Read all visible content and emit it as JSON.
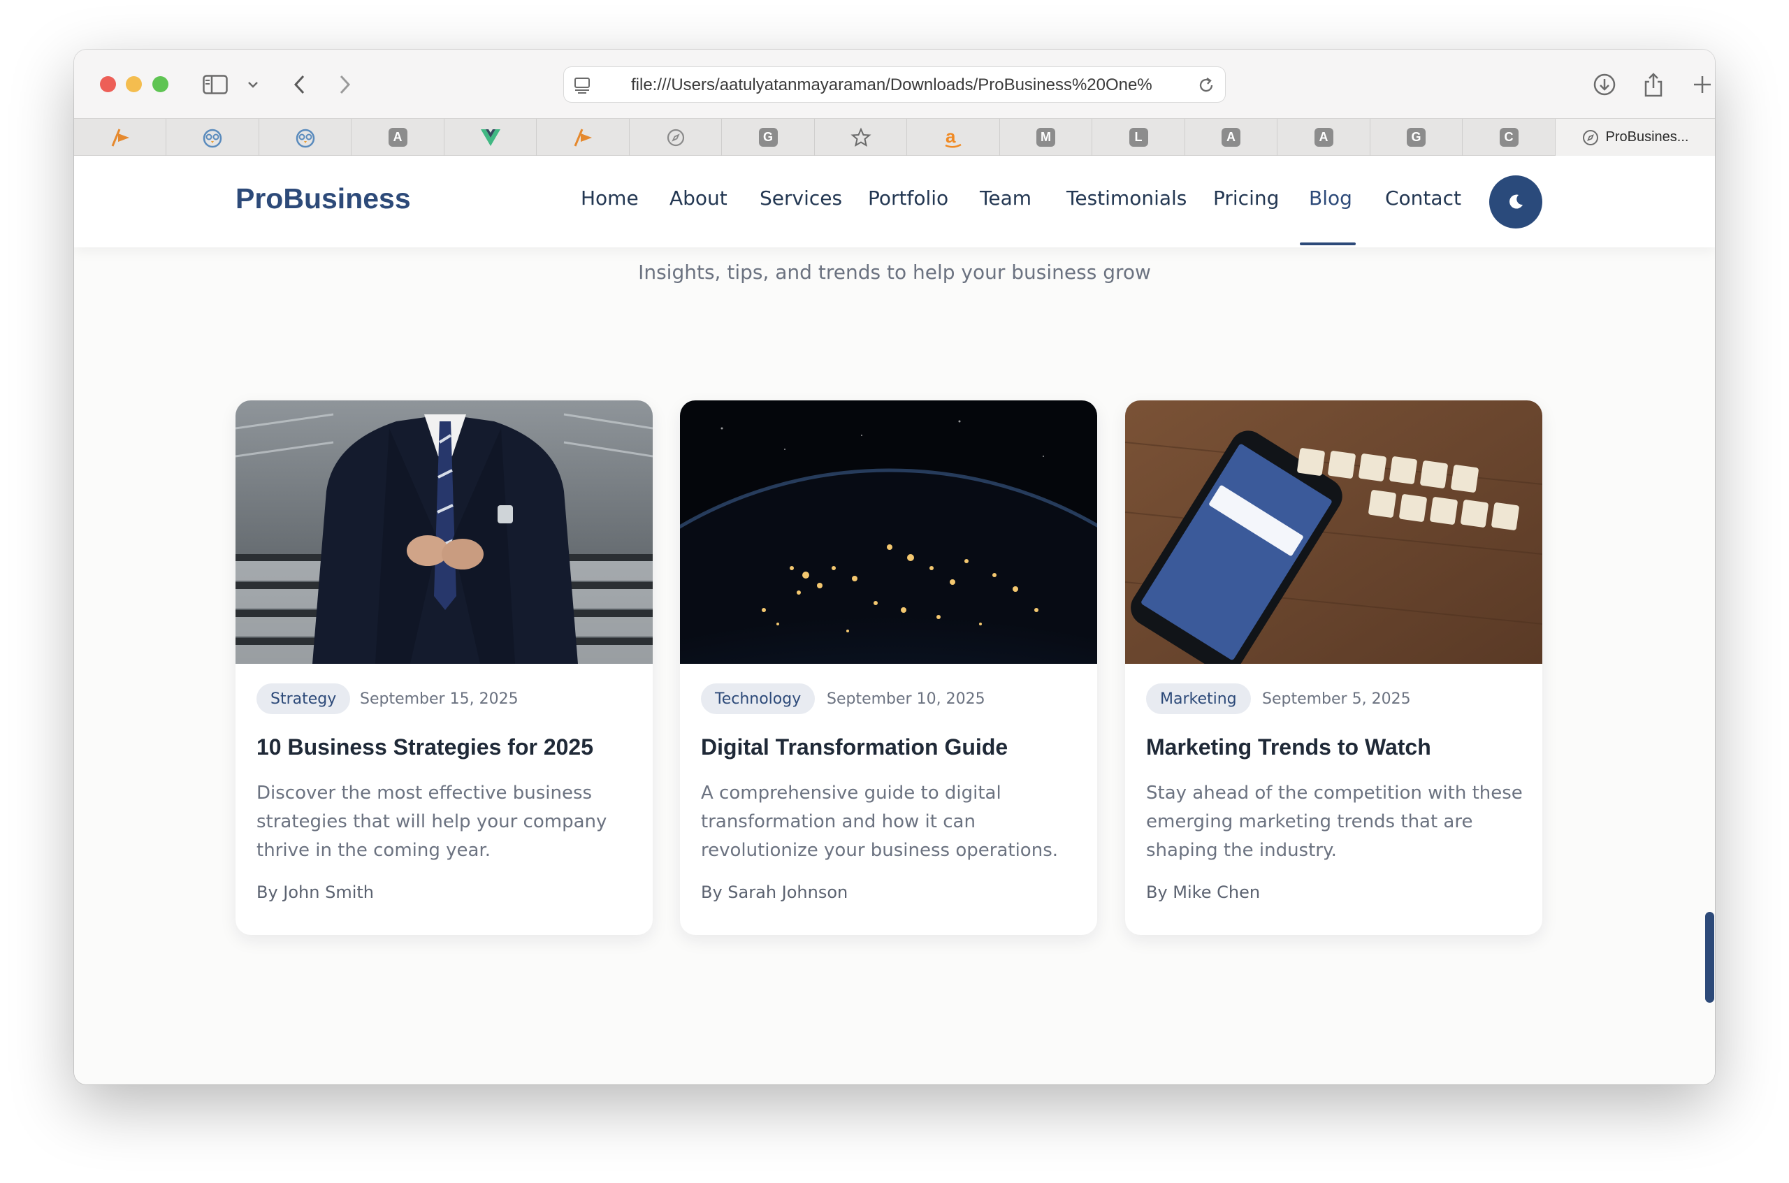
{
  "browser": {
    "url": "file:///Users/aatulyatanmayaraman/Downloads/ProBusiness%20One%",
    "active_tab_title": "ProBusines...",
    "favorites": [
      {
        "kind": "glyph",
        "icon": "orange-arrow-icon",
        "color": "#e5892e"
      },
      {
        "kind": "glyph",
        "icon": "owl-icon",
        "color": "#5a8bbd"
      },
      {
        "kind": "glyph",
        "icon": "owl-icon",
        "color": "#5a8bbd"
      },
      {
        "kind": "letter",
        "letter": "A"
      },
      {
        "kind": "glyph",
        "icon": "vue-icon",
        "color": "#41b883"
      },
      {
        "kind": "glyph",
        "icon": "orange-arrow-icon",
        "color": "#e5892e"
      },
      {
        "kind": "glyph",
        "icon": "compass-icon",
        "color": "#8a8a8a"
      },
      {
        "kind": "letter",
        "letter": "G"
      },
      {
        "kind": "glyph",
        "icon": "star-icon",
        "color": "#6a6a6a"
      },
      {
        "kind": "glyph",
        "icon": "amazon-icon",
        "color": "#f08a24"
      },
      {
        "kind": "letter",
        "letter": "M"
      },
      {
        "kind": "letter",
        "letter": "L"
      },
      {
        "kind": "letter",
        "letter": "A"
      },
      {
        "kind": "letter",
        "letter": "A"
      },
      {
        "kind": "letter",
        "letter": "G"
      },
      {
        "kind": "letter",
        "letter": "C"
      }
    ]
  },
  "site": {
    "brand": "ProBusiness",
    "nav": [
      {
        "label": "Home"
      },
      {
        "label": "About"
      },
      {
        "label": "Services"
      },
      {
        "label": "Portfolio"
      },
      {
        "label": "Team"
      },
      {
        "label": "Testimonials"
      },
      {
        "label": "Pricing"
      },
      {
        "label": "Blog",
        "active": true
      },
      {
        "label": "Contact"
      }
    ],
    "theme_toggle_icon": "moon-icon",
    "accent_color": "#2d4a79"
  },
  "blog": {
    "subtitle": "Insights, tips, and trends to help your business grow",
    "posts": [
      {
        "image": "businessman-suit-image",
        "category": "Strategy",
        "date": "September 15, 2025",
        "title": "10 Business Strategies for 2025",
        "excerpt": "Discover the most effective business strategies that will help your company thrive in the coming year.",
        "author": "By John Smith"
      },
      {
        "image": "earth-night-lights-image",
        "category": "Technology",
        "date": "September 10, 2025",
        "title": "Digital Transformation Guide",
        "excerpt": "A comprehensive guide to digital transformation and how it can revolutionize your business operations.",
        "author": "By Sarah Johnson"
      },
      {
        "image": "social-media-phone-image",
        "category": "Marketing",
        "date": "September 5, 2025",
        "title": "Marketing Trends to Watch",
        "excerpt": "Stay ahead of the competition with these emerging marketing trends that are shaping the industry.",
        "author": "By Mike Chen"
      }
    ]
  }
}
